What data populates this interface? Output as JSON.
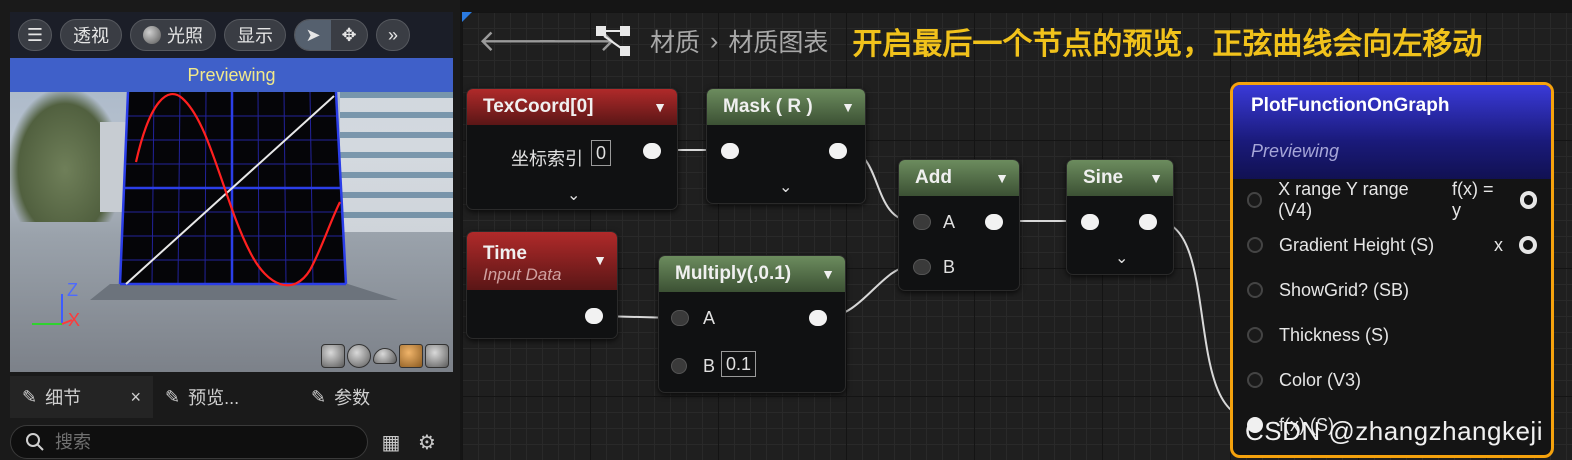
{
  "viewport": {
    "toolbar": {
      "perspective_label": "透视",
      "lighting_label": "光照",
      "show_label": "显示"
    },
    "banner": "Previewing",
    "axis_z": "Z",
    "axis_x": "X"
  },
  "panel_tabs": [
    {
      "label": "细节",
      "close": "×"
    },
    {
      "label": "预览..."
    },
    {
      "label": "参数"
    }
  ],
  "search": {
    "placeholder": "搜索"
  },
  "graph": {
    "breadcrumb": [
      "材质",
      "材质图表"
    ],
    "separator": "›",
    "annotation": "开启最后一个节点的预览，正弦曲线会向左移动"
  },
  "nodes": {
    "texcoord": {
      "title": "TexCoord[0]",
      "field_label": "坐标索引",
      "field_value": "0"
    },
    "mask": {
      "title": "Mask ( R )"
    },
    "time": {
      "title": "Time",
      "subtitle": "Input Data"
    },
    "multiply": {
      "title": "Multiply(,0.1)",
      "pin_a": "A",
      "pin_b": "B",
      "b_value": "0.1"
    },
    "add": {
      "title": "Add",
      "pin_a": "A",
      "pin_b": "B"
    },
    "sine": {
      "title": "Sine"
    },
    "plot": {
      "title": "PlotFunctionOnGraph",
      "subtitle": "Previewing",
      "inputs": [
        "X range Y range (V4)",
        "Gradient Height (S)",
        "ShowGrid? (SB)",
        "Thickness (S)",
        "Color (V3)",
        "f(x) (S)"
      ],
      "outputs": [
        "f(x) = y",
        "x"
      ]
    }
  },
  "watermark": "CSDN @zhangzhangkeji",
  "colors": {
    "accent_orange": "#f5a20d",
    "annotation_yellow": "#f1c21b",
    "banner_blue": "#3f60c9",
    "header_red": "#b02a2a",
    "header_green": "#6c8c5e"
  }
}
